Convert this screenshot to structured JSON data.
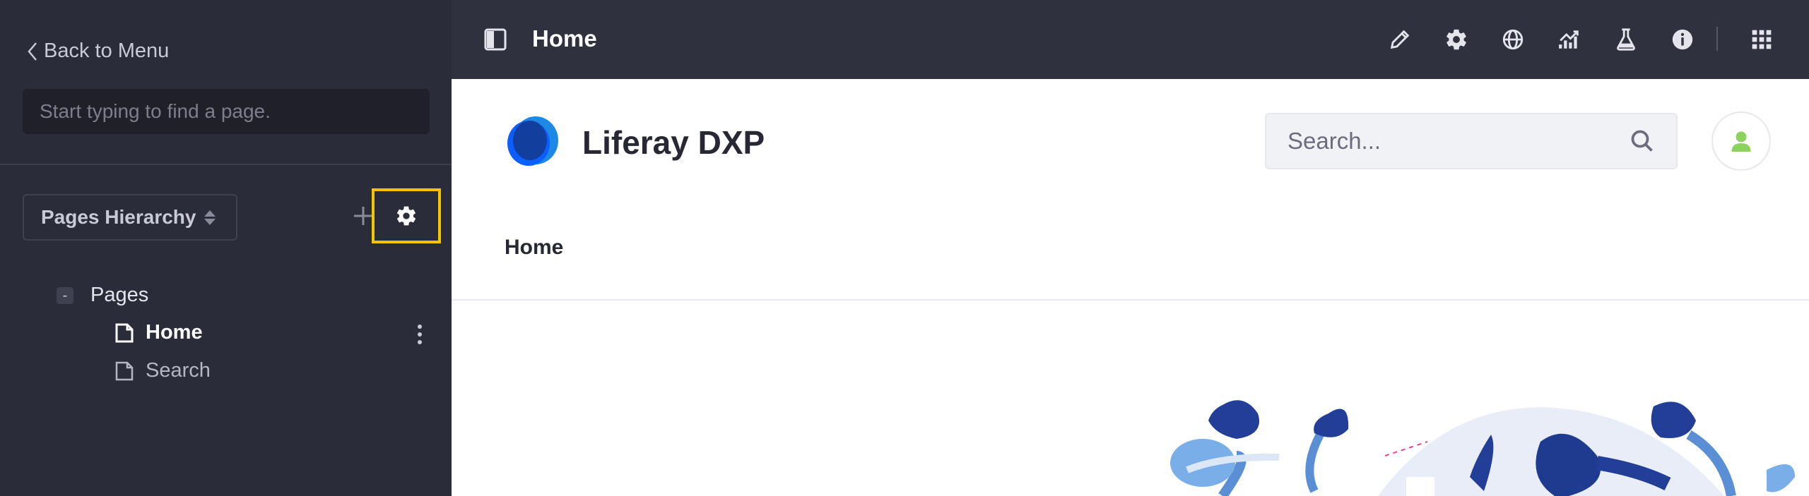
{
  "sidebar": {
    "back_label": "Back to Menu",
    "search_placeholder": "Start typing to find a page.",
    "hierarchy_label": "Pages Hierarchy",
    "tree": {
      "root_label": "Pages",
      "collapse_symbol": "-",
      "items": [
        {
          "label": "Home",
          "selected": true
        },
        {
          "label": "Search",
          "selected": false
        }
      ]
    }
  },
  "topbar": {
    "title": "Home",
    "icons": [
      "pencil-icon",
      "gear-icon",
      "target-icon",
      "analytics-icon",
      "flask-icon",
      "info-icon",
      "apps-icon"
    ]
  },
  "site": {
    "name": "Liferay DXP",
    "search_placeholder": "Search...",
    "nav": [
      "Home"
    ]
  },
  "colors": {
    "sidebar_bg": "#2b2c3a",
    "topbar_bg": "#30313f",
    "highlight": "#f5c400",
    "brand_blue": "#0b5fff",
    "avatar_green": "#8bd25e"
  }
}
